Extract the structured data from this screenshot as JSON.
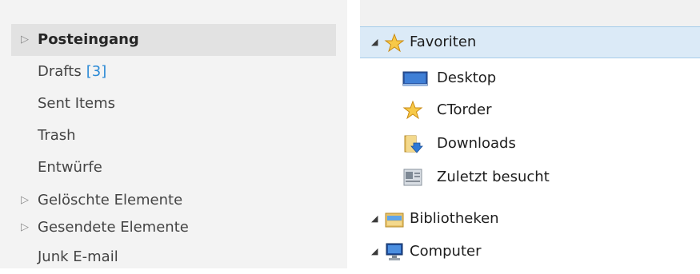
{
  "mail_folders": {
    "items": [
      {
        "label": "Posteingang",
        "expander": "▷",
        "selected": true
      },
      {
        "label": "Drafts",
        "count": "[3]"
      },
      {
        "label": "Sent Items"
      },
      {
        "label": "Trash"
      },
      {
        "label": "Entwürfe"
      },
      {
        "label": "Gelöschte Elemente",
        "expander": "▷"
      },
      {
        "label": "Gesendete Elemente",
        "expander": "▷"
      },
      {
        "label": "Junk E-mail"
      }
    ]
  },
  "nav_tree": {
    "favorites": {
      "label": "Favoriten",
      "expander": "◢",
      "icon": "star-icon"
    },
    "favorites_items": [
      {
        "label": "Desktop",
        "icon": "desktop-icon"
      },
      {
        "label": "CTorder",
        "icon": "star-icon"
      },
      {
        "label": "Downloads",
        "icon": "download-folder-icon"
      },
      {
        "label": "Zuletzt besucht",
        "icon": "recent-places-icon"
      }
    ],
    "libraries": {
      "label": "Bibliotheken",
      "expander": "◢",
      "icon": "libraries-icon"
    },
    "computer": {
      "label": "Computer",
      "expander": "◢",
      "icon": "computer-icon"
    }
  },
  "colors": {
    "mail_pane_bg": "#f3f3f3",
    "mail_selected_bg": "#e2e2e2",
    "count_accent": "#2b8ad6",
    "nav_selected_bg": "#dbeaf7",
    "nav_selected_border": "#a6cdea"
  }
}
